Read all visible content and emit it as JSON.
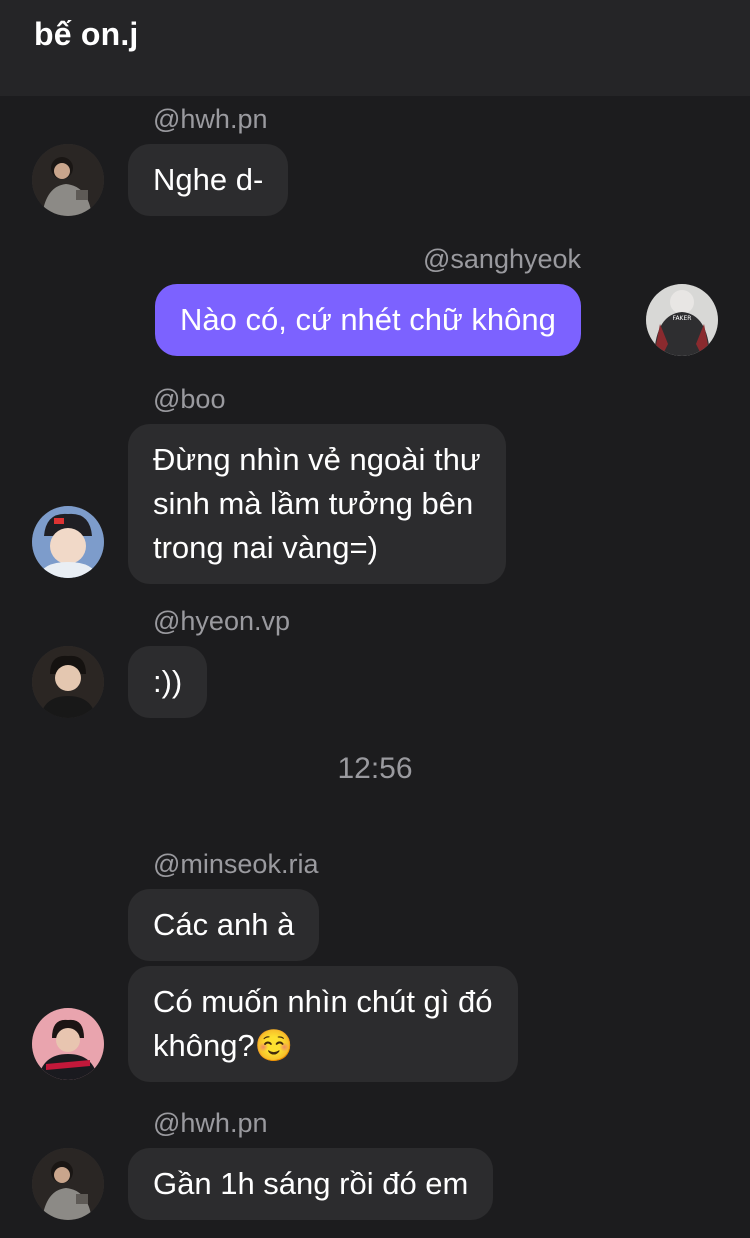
{
  "header": {
    "title": "bế on.j"
  },
  "messages": [
    {
      "username": "@hwh.pn",
      "text": "Nghe d-"
    },
    {
      "username": "@sanghyeok",
      "text": "Nào có, cứ nhét chữ không"
    },
    {
      "username": "@boo",
      "text": "Đừng nhìn vẻ ngoài thư\nsinh mà lầm tưởng bên\ntrong nai vàng=)"
    },
    {
      "username": "@hyeon.vp",
      "text": ":))"
    },
    {
      "timestamp": "12:56"
    },
    {
      "username": "@minseok.ria",
      "text": "Các anh à"
    },
    {
      "text": "Có muốn nhìn chút gì đó\nkhông?☺️"
    },
    {
      "username": "@hwh.pn",
      "text": "Gần 1h sáng rồi đó em"
    }
  ],
  "colors": {
    "background": "#1c1c1e",
    "header": "#252527",
    "bubble_other": "#2c2c2e",
    "bubble_me": "#7c62ff",
    "username": "#9a9a9f"
  },
  "avatars": {
    "hwh": "avatar-photo-dark-hoodie",
    "sanghyeok": "avatar-photo-faker-jacket",
    "boo": "avatar-photo-blue-cap",
    "hyeon": "avatar-photo-dark",
    "minseok": "avatar-photo-pink-background"
  }
}
